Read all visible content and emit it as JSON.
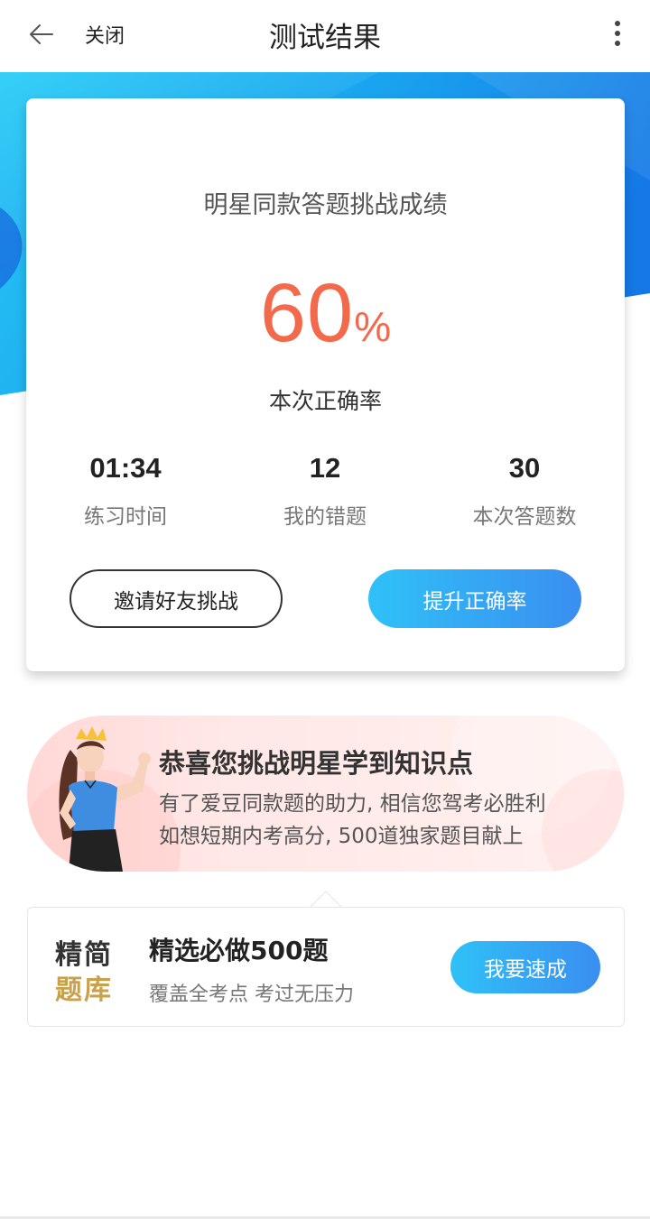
{
  "nav": {
    "close_label": "关闭",
    "title": "测试结果"
  },
  "result": {
    "card_title": "明星同款答题挑战成绩",
    "score_value": "60",
    "score_unit": "%",
    "score_label": "本次正确率",
    "stats": [
      {
        "value": "01:34",
        "label": "练习时间"
      },
      {
        "value": "12",
        "label": "我的错题"
      },
      {
        "value": "30",
        "label": "本次答题数"
      }
    ],
    "invite_button": "邀请好友挑战",
    "improve_button": "提升正确率"
  },
  "congrats": {
    "title": "恭喜您挑战明星学到知识点",
    "line1": "有了爱豆同款题的助力, 相信您驾考必胜利",
    "line2": "如想短期内考高分, 500道独家题目献上"
  },
  "product": {
    "logo_line1": "精简",
    "logo_line2": "题库",
    "title": "精选必做500题",
    "subtitle": "覆盖全考点 考过无压力",
    "button": "我要速成"
  },
  "colors": {
    "accent_orange": "#f26a4b",
    "button_blue_start": "#2fc1f7",
    "button_blue_end": "#3a8ef0",
    "banner_blue": "#1a8fea",
    "logo_gold": "#c9a14d"
  }
}
